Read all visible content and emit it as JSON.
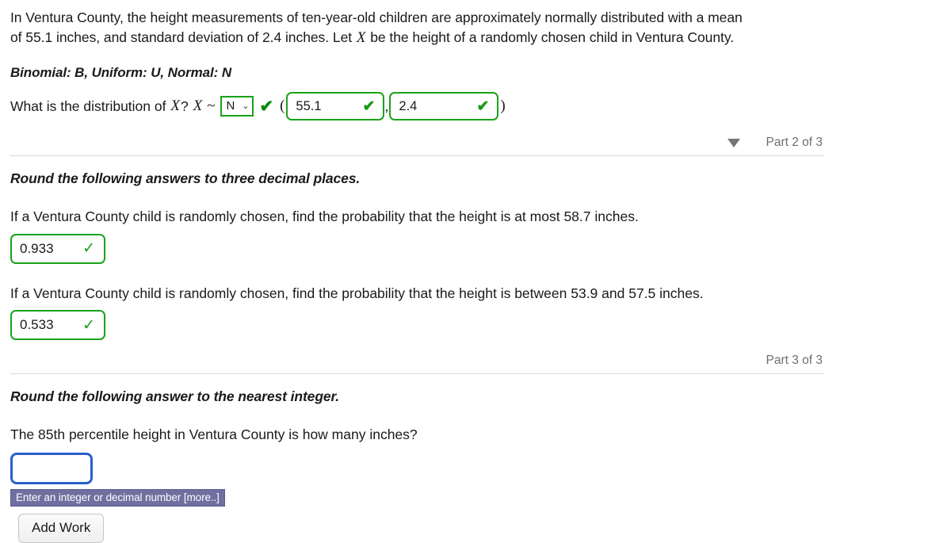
{
  "problem": {
    "statement_part1": "In Ventura County, the height measurements of ten-year-old children are approximately normally distributed with a mean of 55.1 inches, and standard deviation of 2.4 inches. Let ",
    "variable": "X",
    "statement_part2": " be the height of a randomly chosen child in Ventura County."
  },
  "legend": "Binomial: B, Uniform: U, Normal: N",
  "distribution_row": {
    "question_lead": "What is the distribution of ",
    "variable": "X",
    "question_tail": "? ",
    "variable_2": "X",
    "tilde": "~",
    "select_value": "N",
    "select_options": [
      "N",
      "B",
      "U"
    ],
    "chevron": "⌄",
    "check_mark": "✔",
    "open_paren": "(",
    "mean_value": "55.1",
    "mean_check": "✔",
    "comma": ",",
    "sd_value": "2.4",
    "sd_check": "✔",
    "close_paren": ")"
  },
  "part2": {
    "triangle": "▼",
    "label": "Part 2 of 3",
    "instruction": "Round the following answers to three decimal places.",
    "question_a": "If a Ventura County child is randomly chosen, find the probability that the height is at most 58.7 inches.",
    "answer_a": "0.933",
    "answer_a_check": "✓",
    "question_b": "If a Ventura County child is randomly chosen, find the probability that the height is between 53.9 and 57.5 inches.",
    "answer_b": "0.533",
    "answer_b_check": "✓"
  },
  "part3": {
    "label": "Part 3 of 3",
    "instruction": "Round the following answer to the nearest integer.",
    "question": "The 85th percentile height in Ventura County is how many inches?",
    "answer_value": "",
    "answer_placeholder": "",
    "hint": "Enter an integer or decimal number [more..]",
    "add_work_label": "Add Work"
  },
  "colors": {
    "correct_green": "#19a319",
    "focus_blue": "#2b5fcc",
    "hint_purple": "#6f6fa0",
    "muted_gray": "#6e6e6e",
    "divider_gray": "#d9d9d9"
  }
}
